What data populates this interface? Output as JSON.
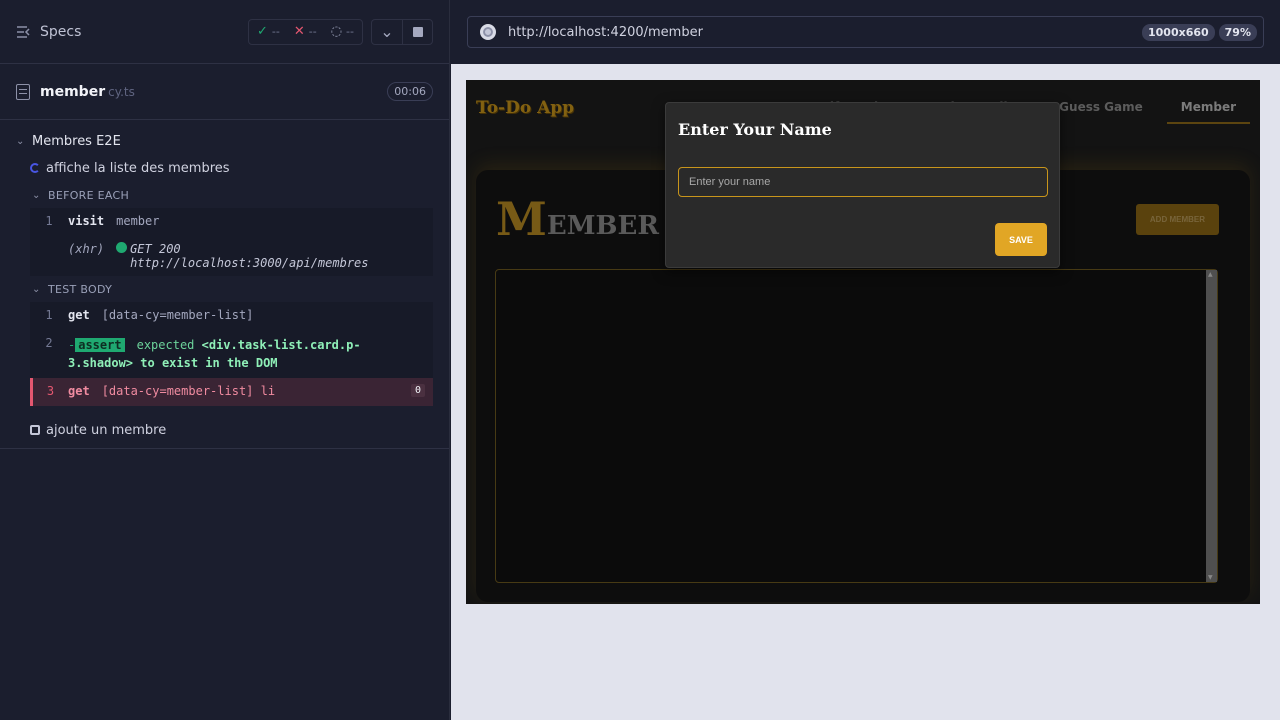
{
  "reporter": {
    "specs_label": "Specs",
    "stats": {
      "passed": "--",
      "failed": "--",
      "pending": "--"
    },
    "spec": {
      "name": "member",
      "ext": "cy.ts",
      "time": "00:06"
    },
    "suite": {
      "title": "Membres E2E",
      "test1_title": "affiche la liste des membres",
      "before_each_label": "BEFORE EACH",
      "before_cmds": [
        {
          "num": "1",
          "name": "visit",
          "msg": "member"
        }
      ],
      "xhr": {
        "name": "(xhr)",
        "msg": "GET 200 http://localhost:3000/api/membres"
      },
      "test_body_label": "TEST BODY",
      "body_cmds": [
        {
          "num": "1",
          "name": "get",
          "msg": "[data-cy=member-list]"
        },
        {
          "num": "2",
          "badge": "assert",
          "expected": "expected",
          "target": "<div.task-list.card.p-3.shadow>",
          "rest": "to exist in the DOM"
        },
        {
          "num": "3",
          "name": "get",
          "msg": "[data-cy=member-list] li",
          "count": "0"
        }
      ],
      "test2_title": "ajoute un membre"
    }
  },
  "aut": {
    "url": "http://localhost:4200/member",
    "viewport": "1000x660",
    "scale": "79%",
    "app": {
      "logo": "To-Do App",
      "nav": [
        "Tarif Service",
        "Todo - Nudity",
        "Guess Game",
        "Member"
      ],
      "title_initial": "M",
      "title_rest": "EMBER",
      "add_member": "ADD MEMBER",
      "modal": {
        "title": "Enter Your Name",
        "placeholder": "Enter your name",
        "save": "SAVE"
      }
    }
  },
  "colors": {
    "pass": "#1fa971",
    "fail": "#e45770",
    "accent_gold": "#c8951b",
    "reporter_bg": "#1b1e2e"
  }
}
